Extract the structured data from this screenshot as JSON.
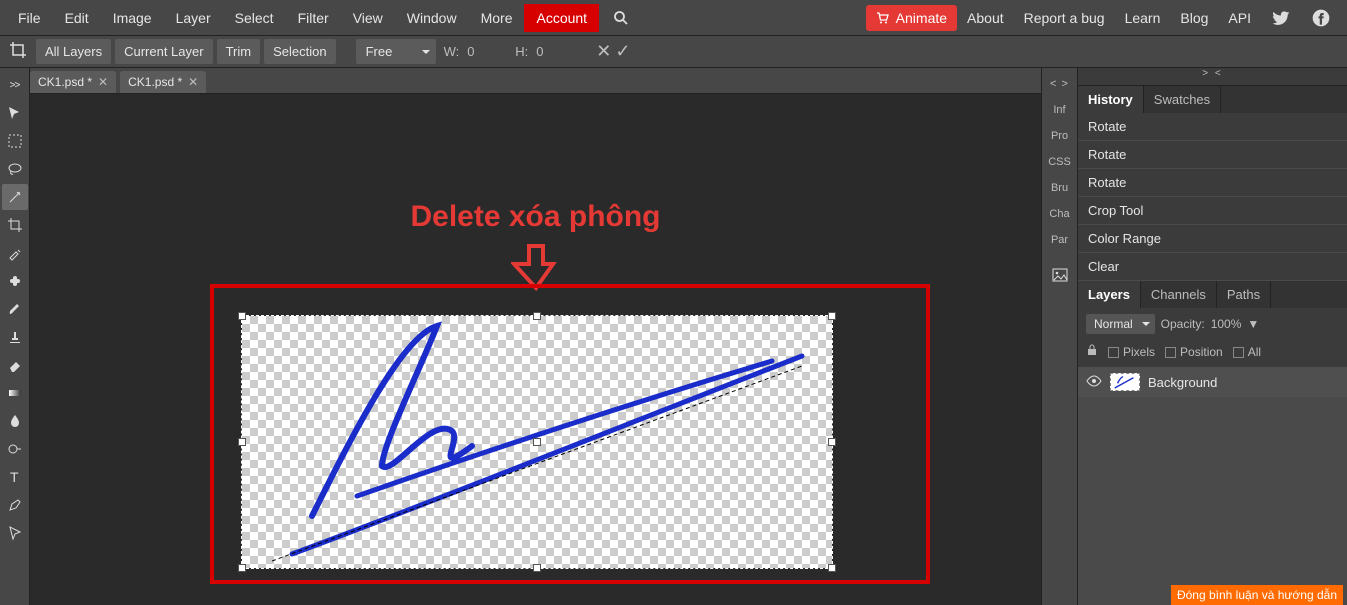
{
  "menu": {
    "items": [
      "File",
      "Edit",
      "Image",
      "Layer",
      "Select",
      "Filter",
      "View",
      "Window",
      "More"
    ],
    "account": "Account"
  },
  "right_menu": {
    "animate": "Animate",
    "links": [
      "About",
      "Report a bug",
      "Learn",
      "Blog",
      "API"
    ]
  },
  "options": {
    "btns": [
      "All Layers",
      "Current Layer",
      "Trim",
      "Selection"
    ],
    "transform": "Free",
    "w_label": "W:",
    "w_val": "0",
    "h_label": "H:",
    "h_val": "0"
  },
  "open_tabs": [
    {
      "title": "CK1.psd *"
    },
    {
      "title": "CK1.psd *"
    }
  ],
  "annotation": {
    "title": "Delete xóa phông"
  },
  "mini_tabs": [
    "Inf",
    "Pro",
    "CSS",
    "Bru",
    "Cha",
    "Par"
  ],
  "mini_header": "< >",
  "panel_header": "> <",
  "hist_tabs": [
    "History",
    "Swatches"
  ],
  "history": [
    "Rotate",
    "Rotate",
    "Rotate",
    "Crop Tool",
    "Color Range",
    "Clear"
  ],
  "lay_tabs": [
    "Layers",
    "Channels",
    "Paths"
  ],
  "layer_opts": {
    "blend": "Normal",
    "opacity_label": "Opacity:",
    "opacity_val": "100%"
  },
  "locks": {
    "pixels": "Pixels",
    "position": "Position",
    "all": "All"
  },
  "layer_name": "Background",
  "footer": "Đóng bình luận và hướng dẫn"
}
